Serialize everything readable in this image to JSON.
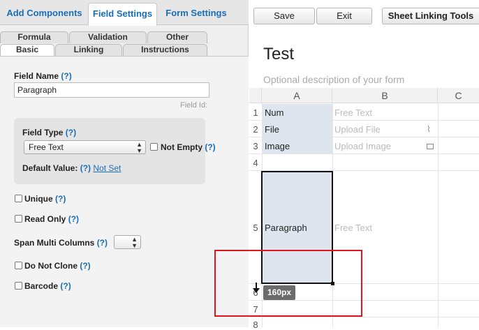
{
  "top_tabs": [
    "Add Components",
    "Field Settings",
    "Form Settings"
  ],
  "sub_tabs_row1": [
    "Formula",
    "Validation",
    "Other"
  ],
  "sub_tabs_row2": [
    "Basic",
    "Linking",
    "Instructions"
  ],
  "field_name": {
    "label": "Field Name",
    "help": "(?)",
    "value": "Paragraph",
    "field_id_label": "Field Id:"
  },
  "field_type": {
    "label": "Field Type",
    "help": "(?)",
    "selected": "Free Text",
    "not_empty_label": "Not Empty",
    "not_empty_help": "(?)",
    "default_value_label": "Default Value:",
    "default_value_help": "(?)",
    "default_value_link": "Not Set"
  },
  "options": {
    "unique": "Unique",
    "read_only": "Read Only",
    "span_multi_columns": "Span Multi Columns",
    "do_not_clone": "Do Not Clone",
    "barcode": "Barcode",
    "help": "(?)"
  },
  "toolbar": {
    "save": "Save",
    "exit": "Exit",
    "sheet_linking": "Sheet Linking Tools"
  },
  "form": {
    "title": "Test",
    "description_placeholder": "Optional description of your form"
  },
  "grid": {
    "columns": [
      "A",
      "B",
      "C"
    ],
    "rows": [
      {
        "num": "1",
        "a": "Num",
        "b": "Free Text",
        "b_icon": ""
      },
      {
        "num": "2",
        "a": "File",
        "b": "Upload File",
        "b_icon": "paperclip-icon"
      },
      {
        "num": "3",
        "a": "Image",
        "b": "Upload Image",
        "b_icon": "image-icon"
      },
      {
        "num": "4",
        "a": "",
        "b": "",
        "b_icon": ""
      },
      {
        "num": "5",
        "a": "Paragraph",
        "b": "Free Text",
        "b_icon": ""
      },
      {
        "num": "6",
        "a": "",
        "b": "",
        "b_icon": ""
      },
      {
        "num": "7",
        "a": "",
        "b": "",
        "b_icon": ""
      },
      {
        "num": "8",
        "a": "",
        "b": "",
        "b_icon": ""
      }
    ],
    "resize_tooltip": "160px"
  },
  "colors": {
    "link": "#1a6eb5",
    "selected_cell": "#dfe5ee",
    "highlight_rect": "#e2151b"
  }
}
